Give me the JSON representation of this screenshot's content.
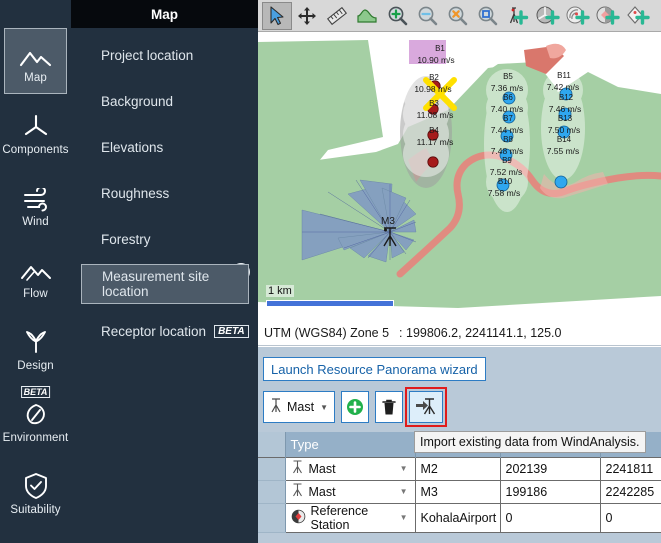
{
  "rail": {
    "items": [
      {
        "label": "Map",
        "icon": "mountains-icon",
        "active": true,
        "beta": false
      },
      {
        "label": "Components",
        "icon": "turbine-rotor-icon",
        "active": false,
        "beta": false
      },
      {
        "label": "Wind",
        "icon": "wind-lines-icon",
        "active": false,
        "beta": false
      },
      {
        "label": "Flow",
        "icon": "flow-mountains-icon",
        "active": false,
        "beta": false
      },
      {
        "label": "Design",
        "icon": "design-turbine-icon",
        "active": false,
        "beta": false
      },
      {
        "label": "Environment",
        "icon": "leaf-icon",
        "active": false,
        "beta": true,
        "beta_label": "BETA"
      },
      {
        "label": "Suitability",
        "icon": "shield-check-icon",
        "active": false,
        "beta": false
      }
    ]
  },
  "panel": {
    "title": "Map",
    "collapse_icon": "chevron-left-icon",
    "items": [
      {
        "label": "Project location",
        "selected": false,
        "beta": false
      },
      {
        "label": "Background",
        "selected": false,
        "beta": false
      },
      {
        "label": "Elevations",
        "selected": false,
        "beta": false
      },
      {
        "label": "Roughness",
        "selected": false,
        "beta": false
      },
      {
        "label": "Forestry",
        "selected": false,
        "beta": false
      },
      {
        "label": "Measurement site location",
        "selected": true,
        "beta": false
      },
      {
        "label": "Receptor location",
        "selected": false,
        "beta": true,
        "beta_label": "BETA"
      }
    ]
  },
  "toolbar": {
    "buttons": [
      {
        "name": "select-arrow-icon",
        "pressed": true
      },
      {
        "name": "pan-move-icon",
        "pressed": false
      },
      {
        "name": "measure-ruler-icon",
        "pressed": false
      },
      {
        "name": "profile-chart-icon",
        "pressed": false
      },
      {
        "name": "zoom-in-icon",
        "pressed": false
      },
      {
        "name": "zoom-out-icon",
        "pressed": false
      },
      {
        "name": "zoom-reset-icon",
        "pressed": false
      },
      {
        "name": "zoom-extent-icon",
        "pressed": false
      },
      {
        "name": "add-mast-icon",
        "pressed": false
      },
      {
        "name": "add-turbine-icon",
        "pressed": false
      },
      {
        "name": "add-reference-station-icon",
        "pressed": false
      },
      {
        "name": "add-resource-grid-icon",
        "pressed": false
      },
      {
        "name": "add-receptor-icon",
        "pressed": false
      }
    ]
  },
  "map": {
    "scalebar_label": "1 km",
    "mast_label": "M3",
    "turbine_groups": [
      {
        "id": "B1",
        "labels": [
          "B1",
          "10.90 m/s",
          "B2",
          "10.98 m/s",
          "B3",
          "11.08 m/s",
          "B4",
          "11.17 m/s"
        ],
        "marker_color": "#a51b1b",
        "selected_marker": "yellow-x-icon"
      },
      {
        "id": "B5",
        "labels": [
          "B5",
          "7.36 m/s",
          "B6",
          "7.40 m/s",
          "B7",
          "7.44 m/s",
          "B8",
          "7.48 m/s",
          "B9",
          "7.52 m/s",
          "B10",
          "7.58 m/s"
        ],
        "marker_color": "#1f9cf0"
      },
      {
        "id": "B11",
        "labels": [
          "B11",
          "7.42 m/s",
          "B12",
          "7.46 m/s",
          "B13",
          "7.50 m/s",
          "B14",
          "7.55 m/s"
        ],
        "marker_color": "#1f9cf0"
      }
    ]
  },
  "coords": {
    "system": "UTM (WGS84) Zone 5",
    "separator": ":",
    "value": "199806.2, 2241141.1, 125.0"
  },
  "actions": {
    "wizard_label": "Launch Resource Panorama wizard",
    "type_select_value": "Mast",
    "type_select_icon": "mast-icon",
    "add_label": "add-icon",
    "delete_label": "trash-icon",
    "import_label": "import-mast-icon",
    "tooltip": "Import existing data from WindAnalysis."
  },
  "table": {
    "columns": [
      "",
      "Type",
      "",
      "",
      ""
    ],
    "headers": {
      "type": "Type"
    },
    "rows": [
      {
        "type": "Mast",
        "icon": "mast-icon",
        "name": "M2",
        "x": "202139",
        "y": "2241811"
      },
      {
        "type": "Mast",
        "icon": "mast-icon",
        "name": "M3",
        "x": "199186",
        "y": "2242285"
      },
      {
        "type": "Reference Station",
        "icon": "reference-station-icon",
        "name": "KohalaAirport",
        "x": "0",
        "y": "0"
      }
    ]
  },
  "colors": {
    "rail_bg": "#22303f",
    "panel_header_bg": "#06090d",
    "selected_bg": "#4c5a68",
    "accent_blue": "#2d7cc4",
    "table_header": "#95b0c8",
    "highlight_red": "#e01b1b"
  }
}
